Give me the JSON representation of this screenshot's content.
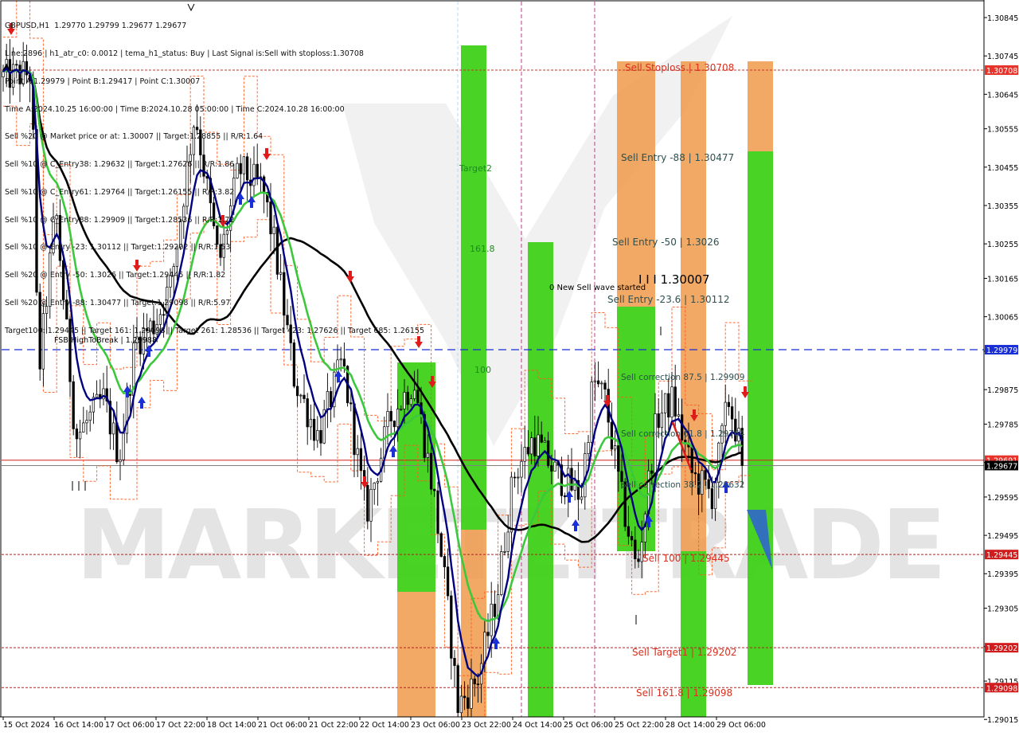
{
  "header": {
    "symbol_line": "GBPUSD,H1  1.29770 1.29799 1.29677 1.29677",
    "lines": [
      "Line:2896 | h1_atr_c0: 0.0012 | tema_h1_status: Buy | Last Signal is:Sell with stoploss:1.30708",
      "Point A:1.29979 | Point B:1.29417 | Point C:1.30007",
      "Time A:2024.10.25 16:00:00 | Time B:2024.10.28 05:00:00 | Time C:2024.10.28 16:00:00",
      "Sell %20 @ Market price or at: 1.30007 || Target:1.28855 || R/R:1.64",
      "Sell %10 @ C_Entry38: 1.29632 || Target:1.27626 || R/R:1.86",
      "Sell %10 @ C_Entry61: 1.29764 || Target:1.26155 || R/R:3.82",
      "Sell %10 @ C_Entry88: 1.29909 || Target:1.28536 || R/R:1.72",
      "Sell %10 @ Entry -23: 1.30112 || Target:1.29202 || R/R:1.53",
      "Sell %20 @ Entry -50: 1.3026 || Target:1.29445 || R/R:1.82",
      "Sell %20 @ Entry -88: 1.30477 || Target:1.29098 || R/R:5.97",
      "Target100: 1.29445 || Target 161: 1.29098 || Target 261: 1.28536 || Target 423: 1.27626 || Target 685: 1.26155"
    ]
  },
  "watermark": "MARKETZITRADE",
  "chart_data": {
    "type": "candlestick",
    "symbol": "GBPUSD",
    "timeframe": "H1",
    "ohlc_last": {
      "open": 1.2977,
      "high": 1.29799,
      "low": 1.29677,
      "close": 1.29677
    },
    "y_axis": {
      "range": [
        1.2903,
        1.3087
      ],
      "ticks": [
        "1.30845",
        "1.30745",
        "1.30645",
        "1.30555",
        "1.30455",
        "1.30355",
        "1.30255",
        "1.30165",
        "1.30065",
        "1.29975",
        "1.29875",
        "1.29785",
        "1.29685",
        "1.29595",
        "1.29495",
        "1.29395",
        "1.29305",
        "1.29205",
        "1.29115",
        "1.29015"
      ]
    },
    "x_axis": {
      "labels": [
        "15 Oct 2024",
        "16 Oct 14:00",
        "17 Oct 06:00",
        "17 Oct 22:00",
        "18 Oct 14:00",
        "21 Oct 06:00",
        "21 Oct 22:00",
        "22 Oct 14:00",
        "23 Oct 06:00",
        "23 Oct 22:00",
        "24 Oct 14:00",
        "25 Oct 06:00",
        "25 Oct 22:00",
        "28 Oct 14:00",
        "29 Oct 06:00"
      ]
    },
    "price_tags": [
      {
        "value": "1.30708",
        "price": 1.30708,
        "bg": "#e8332a",
        "fg": "#ffffff"
      },
      {
        "value": "1.29979",
        "price": 1.29979,
        "bg": "#1a2fd6",
        "fg": "#ffffff"
      },
      {
        "value": "1.29691",
        "price": 1.29691,
        "bg": "#e8332a",
        "fg": "#ffffff"
      },
      {
        "value": "1.29677",
        "price": 1.29677,
        "bg": "#000000",
        "fg": "#ffffff"
      },
      {
        "value": "1.29445",
        "price": 1.29445,
        "bg": "#d01c1c",
        "fg": "#ffffff"
      },
      {
        "value": "1.29202",
        "price": 1.29202,
        "bg": "#d01c1c",
        "fg": "#ffffff"
      },
      {
        "value": "1.29098",
        "price": 1.29098,
        "bg": "#d01c1c",
        "fg": "#ffffff"
      }
    ],
    "levels": [
      {
        "name": "sell-stoploss",
        "price": 1.30708,
        "color": "#c0392b",
        "style": "dotted"
      },
      {
        "name": "point-a",
        "price": 1.29979,
        "color": "#1a2fd6",
        "style": "dashed"
      },
      {
        "name": "market-red",
        "price": 1.29691,
        "color": "#d41e1e",
        "style": "solid"
      },
      {
        "name": "close-grey",
        "price": 1.29677,
        "color": "#808080",
        "style": "solid"
      },
      {
        "name": "target-100",
        "price": 1.29445,
        "color": "#b22222",
        "style": "dotted"
      },
      {
        "name": "target-1",
        "price": 1.29202,
        "color": "#b22222",
        "style": "dotted"
      },
      {
        "name": "target-161",
        "price": 1.29098,
        "color": "#b22222",
        "style": "dotted"
      }
    ],
    "zone_labels": [
      {
        "text": "Sell Stoploss | 1.30708",
        "price": 1.30708,
        "color": "#d9301f"
      },
      {
        "text": "Sell Entry -88 | 1.30477",
        "price": 1.30477,
        "color": "#2e5050"
      },
      {
        "text": "Sell Entry -50 | 1.3026",
        "price": 1.3026,
        "color": "#2e5050"
      },
      {
        "text": "I I I 1.30007",
        "price": 1.30007,
        "color": "#000000"
      },
      {
        "text": "Sell Entry -23.6 | 1.30112",
        "price": 1.30112,
        "color": "#2e5050"
      },
      {
        "text": "0 New Sell wave started",
        "price": 1.30112,
        "color": "#000000"
      },
      {
        "text": "Sell correction 87.5 | 1.29909",
        "price": 1.29909,
        "color": "#2e5050"
      },
      {
        "text": "Sell correction 61.8 | 1.29764",
        "price": 1.29764,
        "color": "#2e5050"
      },
      {
        "text": "Sell correction 38.2 | 1.29632",
        "price": 1.29632,
        "color": "#2e5050"
      },
      {
        "text": "Sell 100 | 1.29445",
        "price": 1.29445,
        "color": "#d9301f"
      },
      {
        "text": "Sell Target1 | 1.29202",
        "price": 1.29202,
        "color": "#d9301f"
      },
      {
        "text": "Sell 161.8 | 1.29098",
        "price": 1.29098,
        "color": "#d9301f"
      },
      {
        "text": "FSB-HighToBreak | 1.29988",
        "price": 1.29979,
        "color": "#000000"
      },
      {
        "text": "Target2",
        "price": 1.3049,
        "color": "#1c8c1c"
      },
      {
        "text": "161.8",
        "price": 1.3019,
        "color": "#1c8c1c"
      },
      {
        "text": "100",
        "price": 1.29895,
        "color": "#1c8c1c"
      }
    ],
    "series": [
      {
        "name": "TEMA",
        "color": "#000080"
      },
      {
        "name": "MA fast",
        "color": "#3cc83c"
      },
      {
        "name": "MA slow",
        "color": "#000000"
      }
    ],
    "colors": {
      "bull": "#000000",
      "bear": "#000000",
      "green_zone": "#3fd119",
      "orange_zone": "#ee9a4a",
      "band": "#ff5a1e"
    }
  }
}
